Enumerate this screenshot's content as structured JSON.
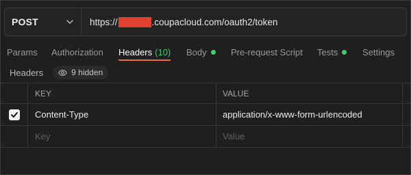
{
  "request": {
    "method": "POST",
    "url_prefix": "https://",
    "url_suffix": ".coupacloud.com/oauth2/token"
  },
  "tabs": [
    {
      "label": "Params"
    },
    {
      "label": "Authorization"
    },
    {
      "label": "Headers",
      "count": "(10)",
      "active": true
    },
    {
      "label": "Body",
      "indicator": true
    },
    {
      "label": "Pre-request Script"
    },
    {
      "label": "Tests",
      "indicator": true
    },
    {
      "label": "Settings"
    }
  ],
  "headers_section": {
    "title": "Headers",
    "hidden_label": "9 hidden"
  },
  "table": {
    "columns": {
      "key": "KEY",
      "value": "VALUE"
    },
    "rows": [
      {
        "checked": true,
        "key": "Content-Type",
        "value": "application/x-www-form-urlencoded"
      }
    ],
    "placeholder": {
      "key": "Key",
      "value": "Value"
    }
  },
  "colors": {
    "accent": "#f26b3a",
    "indicator": "#3ecf6e",
    "redaction": "#e2402e"
  }
}
